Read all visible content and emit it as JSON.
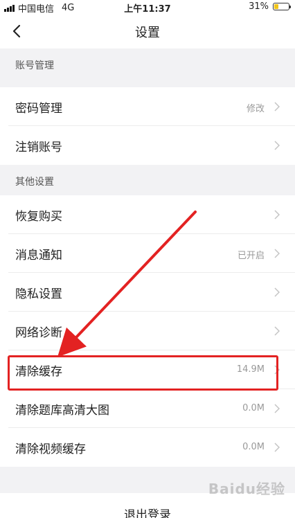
{
  "status_bar": {
    "carrier": "中国电信",
    "network": "4G",
    "time": "上午11:37",
    "battery": "31%",
    "battery_level": 0.31
  },
  "nav": {
    "title": "设置"
  },
  "sections": [
    {
      "header": "账号管理",
      "rows": [
        {
          "label": "密码管理",
          "value": "修改"
        },
        {
          "label": "注销账号",
          "value": ""
        }
      ]
    },
    {
      "header": "其他设置",
      "rows": [
        {
          "label": "恢复购买",
          "value": ""
        },
        {
          "label": "消息通知",
          "value": "已开启"
        },
        {
          "label": "隐私设置",
          "value": ""
        },
        {
          "label": "网络诊断",
          "value": ""
        },
        {
          "label": "清除缓存",
          "value": "14.9M"
        },
        {
          "label": "清除题库高清大图",
          "value": "0.0M"
        },
        {
          "label": "清除视频缓存",
          "value": "0.0M"
        }
      ]
    }
  ],
  "logout": {
    "label": "退出登录"
  },
  "annotation": {
    "color": "#e32222"
  },
  "watermark": {
    "text": "Baidu经验"
  }
}
